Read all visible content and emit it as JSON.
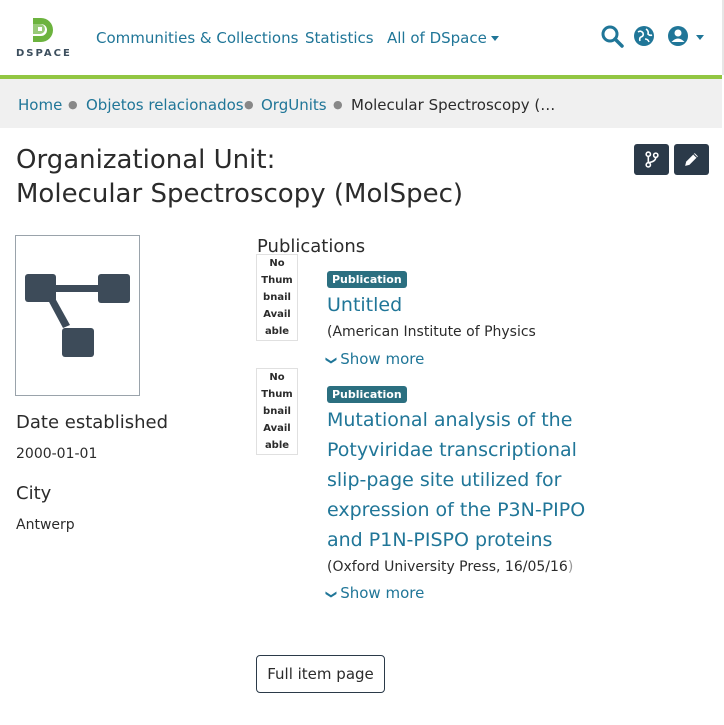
{
  "header": {
    "logo_text": "DSPACE",
    "nav": {
      "communities": "Communities & Collections",
      "statistics": "Statistics",
      "all_of_dspace": "All of DSpace"
    }
  },
  "breadcrumb": {
    "items": [
      "Home",
      "Objetos relacionados",
      "OrgUnits"
    ],
    "current": "Molecular Spectroscopy (…"
  },
  "page": {
    "title_line1": "Organizational Unit:",
    "title_line2": "Molecular Spectroscopy (MolSpec)"
  },
  "fields": {
    "date_label": "Date established",
    "date_value": "2000-01-01",
    "city_label": "City",
    "city_value": "Antwerp"
  },
  "publications": {
    "heading": "Publications",
    "no_thumb_lines": [
      "No",
      "Thum",
      "bnail",
      "Avail",
      "able"
    ],
    "items": [
      {
        "badge": "Publication",
        "title": "Untitled",
        "meta": "(American Institute of Physics",
        "meta_fade": "",
        "show_more": "Show more"
      },
      {
        "badge": "Publication",
        "title": "Mutational analysis of the Potyviridae transcriptional slip-page site utilized for expression of the P3N-PIPO and P1N-PISPO proteins",
        "meta": "(Oxford University Press, 16/05/16",
        "meta_fade": ")",
        "show_more": "Show more"
      }
    ]
  },
  "full_item_button": "Full item page",
  "colors": {
    "link": "#207698",
    "accent_green": "#92c642",
    "dark_button": "#2b3a49",
    "badge": "#2b6f80"
  }
}
